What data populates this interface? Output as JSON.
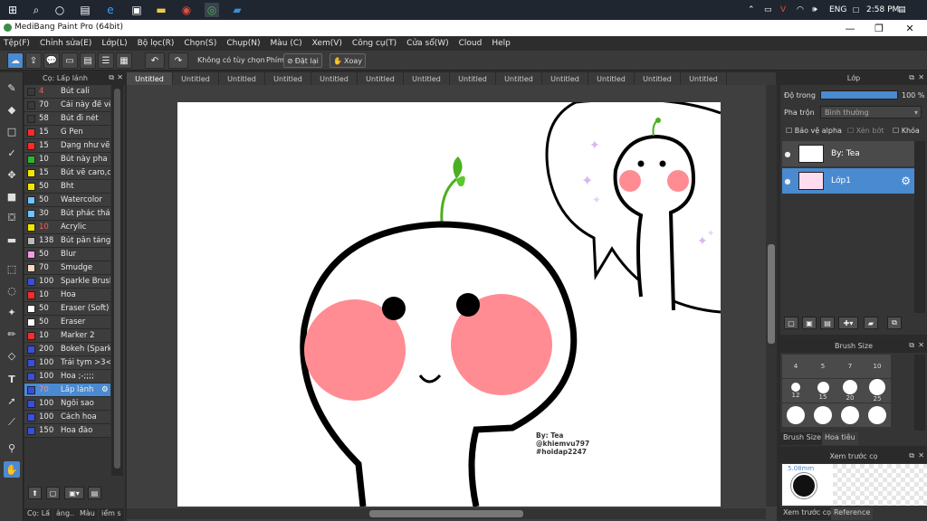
{
  "taskbar": {
    "lang": "ENG",
    "time": "2:58 PM"
  },
  "window": {
    "title": "MediBang Paint Pro (64bit)"
  },
  "menu": [
    "Tệp(F)",
    "Chỉnh sửa(E)",
    "Lớp(L)",
    "Bộ lọc(R)",
    "Chọn(S)",
    "Chụp(N)",
    "Màu (C)",
    "Xem(V)",
    "Công cụ(T)",
    "Cửa sổ(W)",
    "Cloud",
    "Help"
  ],
  "toolbar": {
    "no_options": "Không có tùy chọn",
    "key_label": "Phím",
    "reset": "Đặt lại",
    "rotate": "Xoay"
  },
  "brush_panel": {
    "title": "Cọ: Lấp lánh",
    "brushes": [
      {
        "size": "4",
        "name": "Bút cali",
        "color": "#3a3a3a",
        "size_color": "#ff5a5a"
      },
      {
        "size": "70",
        "name": "Cái này để vẽ",
        "color": "#3a3a3a",
        "size_color": "#e8e8e8"
      },
      {
        "size": "58",
        "name": "Bút đi nét",
        "color": "#3a3a3a",
        "size_color": "#e8e8e8"
      },
      {
        "size": "15",
        "name": "G Pen",
        "color": "#ff2a2a",
        "size_color": "#e8e8e8"
      },
      {
        "size": "15",
        "name": "Dạng như vẽ",
        "color": "#ff2a2a",
        "size_color": "#e8e8e8"
      },
      {
        "size": "10",
        "name": "Bút này pha",
        "color": "#2db52d",
        "size_color": "#e8e8e8"
      },
      {
        "size": "15",
        "name": "Bút vẽ caro,c",
        "color": "#f2e600",
        "size_color": "#e8e8e8"
      },
      {
        "size": "50",
        "name": "Bht",
        "color": "#f2e600",
        "size_color": "#e8e8e8"
      },
      {
        "size": "50",
        "name": "Watercolor",
        "color": "#6fc3ff",
        "size_color": "#e8e8e8"
      },
      {
        "size": "30",
        "name": "Bút phác thả",
        "color": "#6fc3ff",
        "size_color": "#e8e8e8"
      },
      {
        "size": "10",
        "name": "Acrylic",
        "color": "#f2e600",
        "size_color": "#ff5a5a"
      },
      {
        "size": "138",
        "name": "Bút pân táng",
        "color": "#bbbbbb",
        "size_color": "#e8e8e8"
      },
      {
        "size": "50",
        "name": "Blur",
        "color": "#f59ae8",
        "size_color": "#e8e8e8"
      },
      {
        "size": "70",
        "name": "Smudge",
        "color": "#f7d9c4",
        "size_color": "#e8e8e8"
      },
      {
        "size": "100",
        "name": "Sparkle Brush",
        "color": "#3a4fd8",
        "size_color": "#e8e8e8"
      },
      {
        "size": "10",
        "name": "Hoa",
        "color": "#ff2a2a",
        "size_color": "#e8e8e8"
      },
      {
        "size": "50",
        "name": "Eraser (Soft)",
        "color": "#ffffff",
        "size_color": "#e8e8e8"
      },
      {
        "size": "50",
        "name": "Eraser",
        "color": "#ffffff",
        "size_color": "#e8e8e8"
      },
      {
        "size": "10",
        "name": "Marker 2",
        "color": "#ff2a2a",
        "size_color": "#e8e8e8"
      },
      {
        "size": "200",
        "name": "Bokeh (Spark",
        "color": "#3a4fd8",
        "size_color": "#e8e8e8"
      },
      {
        "size": "100",
        "name": "Trái tym >3<",
        "color": "#3a4fd8",
        "size_color": "#e8e8e8"
      },
      {
        "size": "100",
        "name": "Hoa ;-;;;;",
        "color": "#3a4fd8",
        "size_color": "#e8e8e8"
      },
      {
        "size": "70",
        "name": "Lấp lánh",
        "color": "#3a4fd8",
        "size_color": "#ff8a8a",
        "selected": true
      },
      {
        "size": "100",
        "name": "Ngôi sao",
        "color": "#3a4fd8",
        "size_color": "#e8e8e8"
      },
      {
        "size": "100",
        "name": "Cách hoa",
        "color": "#3a4fd8",
        "size_color": "#e8e8e8"
      },
      {
        "size": "150",
        "name": "Hoa đào",
        "color": "#3a4fd8",
        "size_color": "#e8e8e8"
      }
    ],
    "bottom_tabs": [
      "Cọ: Lấ",
      "ảng..",
      "Màu",
      "iểm s"
    ]
  },
  "doc_tabs": [
    "Untitled",
    "Untitled",
    "Untitled",
    "Untitled",
    "Untitled",
    "Untitled",
    "Untitled",
    "Untitled",
    "Untitled",
    "Untitled",
    "Untitled",
    "Untitled",
    "Untitled"
  ],
  "canvas": {
    "signature_line1": "By: Tea",
    "signature_line2": "@khiemvu797",
    "signature_line3": "#hoidap2247"
  },
  "layer_panel": {
    "title": "Lớp",
    "opacity_label": "Độ trong",
    "opacity_value": "100 %",
    "opacity": 1.0,
    "blend_label": "Pha trộn",
    "blend_value": "Bình thường",
    "protect_alpha": "Bảo vệ alpha",
    "clipping": "Xén bớt",
    "lock": "Khóa",
    "layers": [
      {
        "name": "By: Tea",
        "selected": false
      },
      {
        "name": "Lớp1",
        "selected": true
      }
    ]
  },
  "brush_size_panel": {
    "title": "Brush Size",
    "sizes": [
      "4",
      "5",
      "7",
      "10",
      "12",
      "15",
      "20",
      "25",
      "",
      "",
      "",
      ""
    ],
    "tabs": [
      "Brush Size",
      "Hoa tiêu"
    ]
  },
  "preview_panel": {
    "title": "Xem trước cọ",
    "size_readout": "5.08mm",
    "tabs": [
      "Xem trước cọ",
      "Reference"
    ]
  },
  "colors": {
    "accent": "#4a8ad0",
    "cheek": "#ff8c92",
    "sprout": "#4caf1f"
  }
}
